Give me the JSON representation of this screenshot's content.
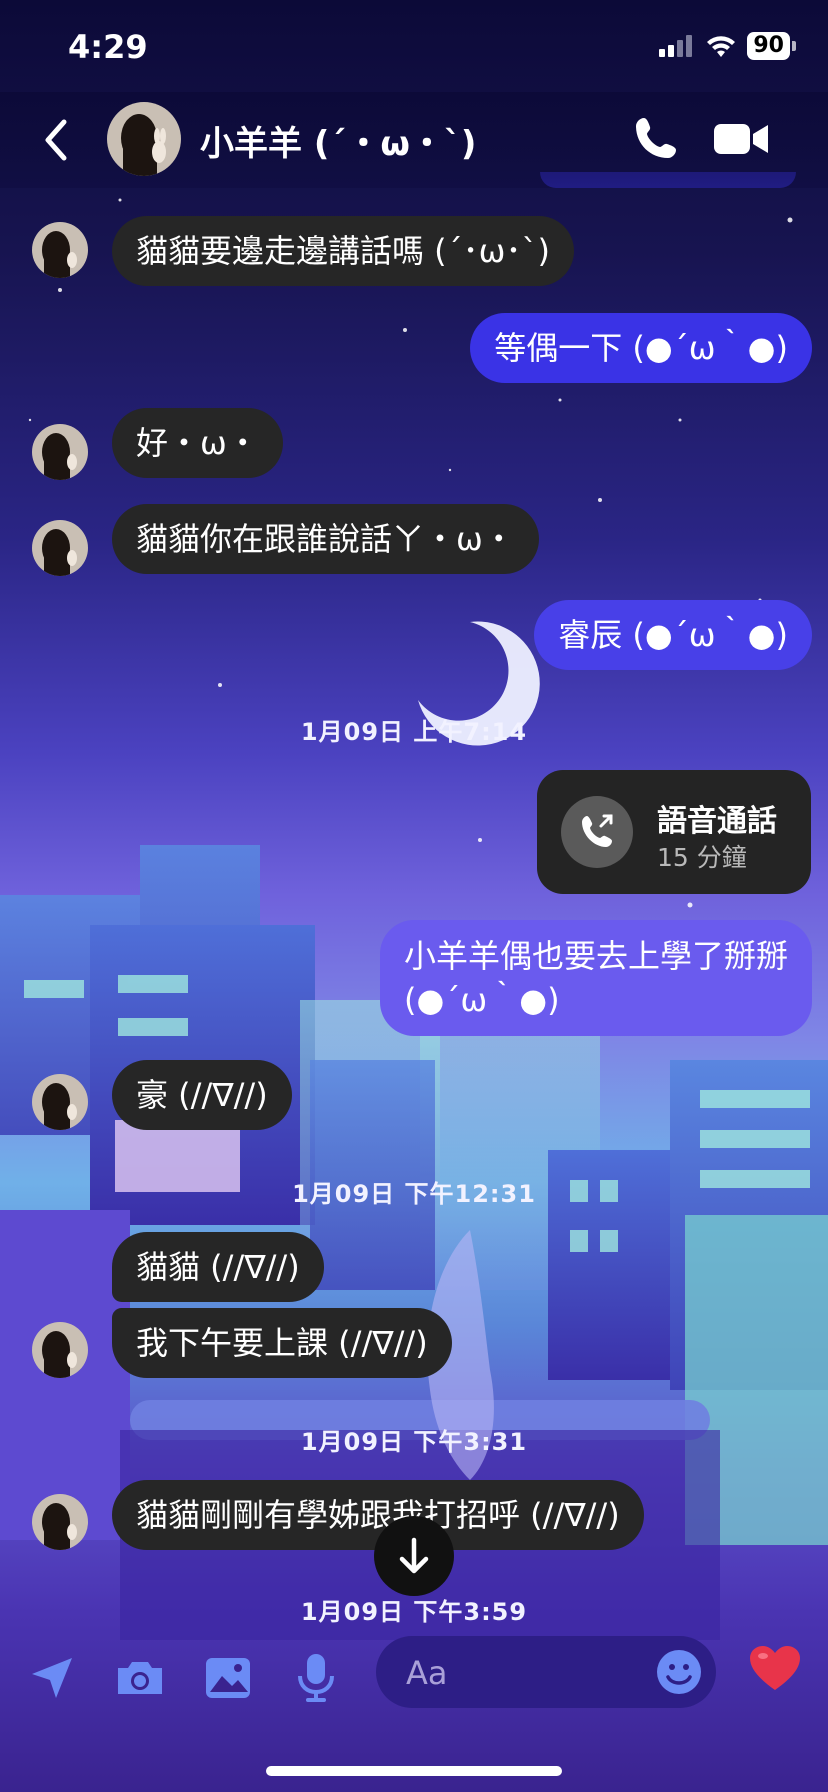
{
  "status": {
    "time": "4:29",
    "battery": "90"
  },
  "header": {
    "contact_name": "小羊羊 (´・ω・`)"
  },
  "messages": {
    "m1": "貓貓要邊走邊講話嗎 (´･ω･`)",
    "m2": "等偶一下 (●´ω｀●)",
    "m3": "好・ω・",
    "m4": "貓貓你在跟誰說話ㄚ・ω・",
    "m5": "睿辰 (●´ω｀●)",
    "ts1": "1月09日 上午7:14",
    "call_title": "語音通話",
    "call_duration": "15 分鐘",
    "m6_line1": "小羊羊偶也要去上學了掰掰",
    "m6_line2": "(●´ω｀●)",
    "m7": "豪 (//∇//)",
    "ts2": "1月09日 下午12:31",
    "m8": "貓貓 (//∇//)",
    "m9": "我下午要上課 (//∇//)",
    "ts3": "1月09日 下午3:31",
    "m10": "貓貓剛剛有學姊跟我打招呼 (//∇//)",
    "ts4": "1月09日 下午3:59"
  },
  "composer": {
    "placeholder": "Aa"
  },
  "icons": {
    "back": "chevron-left-icon",
    "call": "phone-icon",
    "video": "video-camera-icon",
    "location": "location-arrow-icon",
    "camera": "camera-icon",
    "gallery": "image-icon",
    "mic": "microphone-icon",
    "emoji": "smiley-icon",
    "like": "heart-icon",
    "scroll": "arrow-down-icon",
    "voice_call": "phone-call-icon"
  },
  "colors": {
    "outgoing_bubble": "#3a33e6",
    "incoming_bubble": "#262626",
    "accent": "#e8344a"
  }
}
